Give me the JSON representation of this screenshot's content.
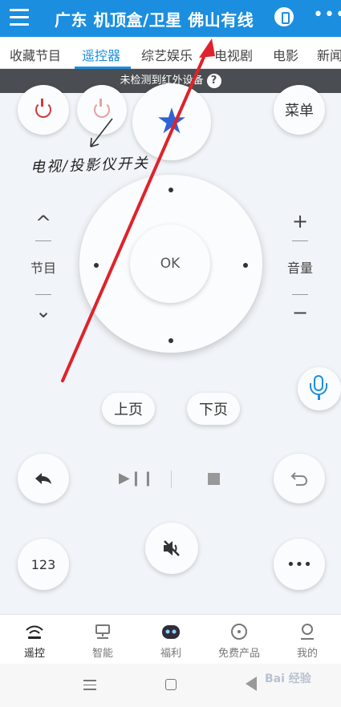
{
  "header": {
    "title": "广东 机顶盒/卫星 佛山有线",
    "more_icon": "more-dots-icon"
  },
  "tabs": [
    {
      "label": "收藏节目",
      "active": false
    },
    {
      "label": "遥控器",
      "active": true
    },
    {
      "label": "综艺娱乐",
      "active": false
    },
    {
      "label": "电视剧",
      "active": false
    },
    {
      "label": "电影",
      "active": false
    },
    {
      "label": "新闻",
      "active": false
    }
  ],
  "notice": {
    "text": "未检测到红外设备",
    "help": "?"
  },
  "remote": {
    "menu_label": "菜单",
    "ok_label": "OK",
    "left_side": {
      "label": "节目",
      "up": "^",
      "down": "⌄"
    },
    "right_side": {
      "label": "音量",
      "up": "+",
      "down": "−"
    },
    "page_up": "上页",
    "page_down": "下页",
    "num_label": "123",
    "more_label": "•••"
  },
  "annotation": {
    "text": "电视/投影仪开关"
  },
  "bottom_nav": [
    {
      "label": "遥控",
      "icon": "remote-wifi-icon",
      "active": true
    },
    {
      "label": "智能",
      "icon": "smart-device-icon",
      "active": false
    },
    {
      "label": "福利",
      "icon": "robot-face-icon",
      "active": false
    },
    {
      "label": "免费产品",
      "icon": "free-product-icon",
      "active": false
    },
    {
      "label": "我的",
      "icon": "user-icon",
      "active": false
    }
  ],
  "watermark": {
    "text": "Bai 经验"
  },
  "colors": {
    "primary": "#1b8ee0",
    "power": "#d03a3a",
    "star": "#3162d4",
    "annotation_arrow": "#e0222a"
  }
}
